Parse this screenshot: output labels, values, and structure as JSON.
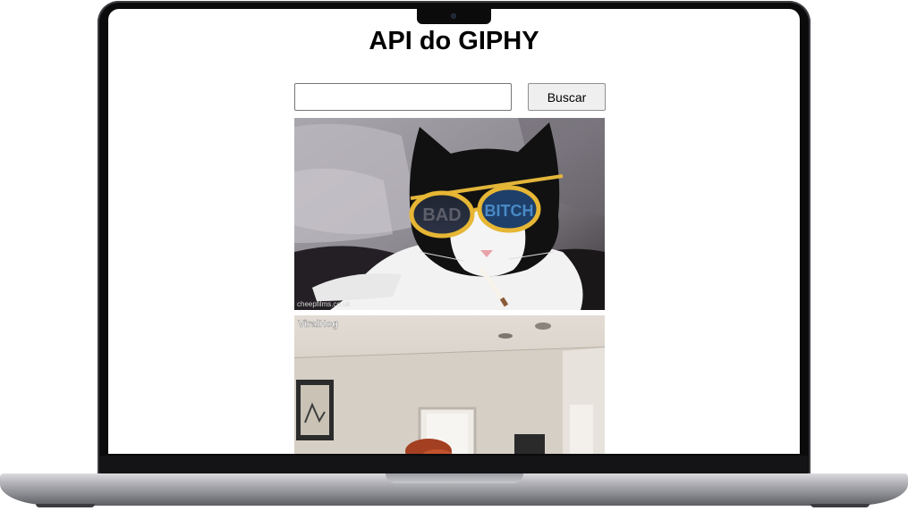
{
  "page": {
    "title": "API do GIPHY"
  },
  "search": {
    "value": "",
    "placeholder": "",
    "button_label": "Buscar"
  },
  "results": [
    {
      "alt": "cat wearing sunglasses smoking",
      "lens_text_left": "BAD",
      "lens_text_right": "BITCH",
      "watermark": "cheepfilms.co.uk"
    },
    {
      "alt": "room interior gif",
      "watermark": "ViralHog"
    }
  ],
  "colors": {
    "frame": "#0b0b0c",
    "base": "#b8b8bd",
    "button_bg": "#efefef",
    "input_border": "#767676"
  }
}
